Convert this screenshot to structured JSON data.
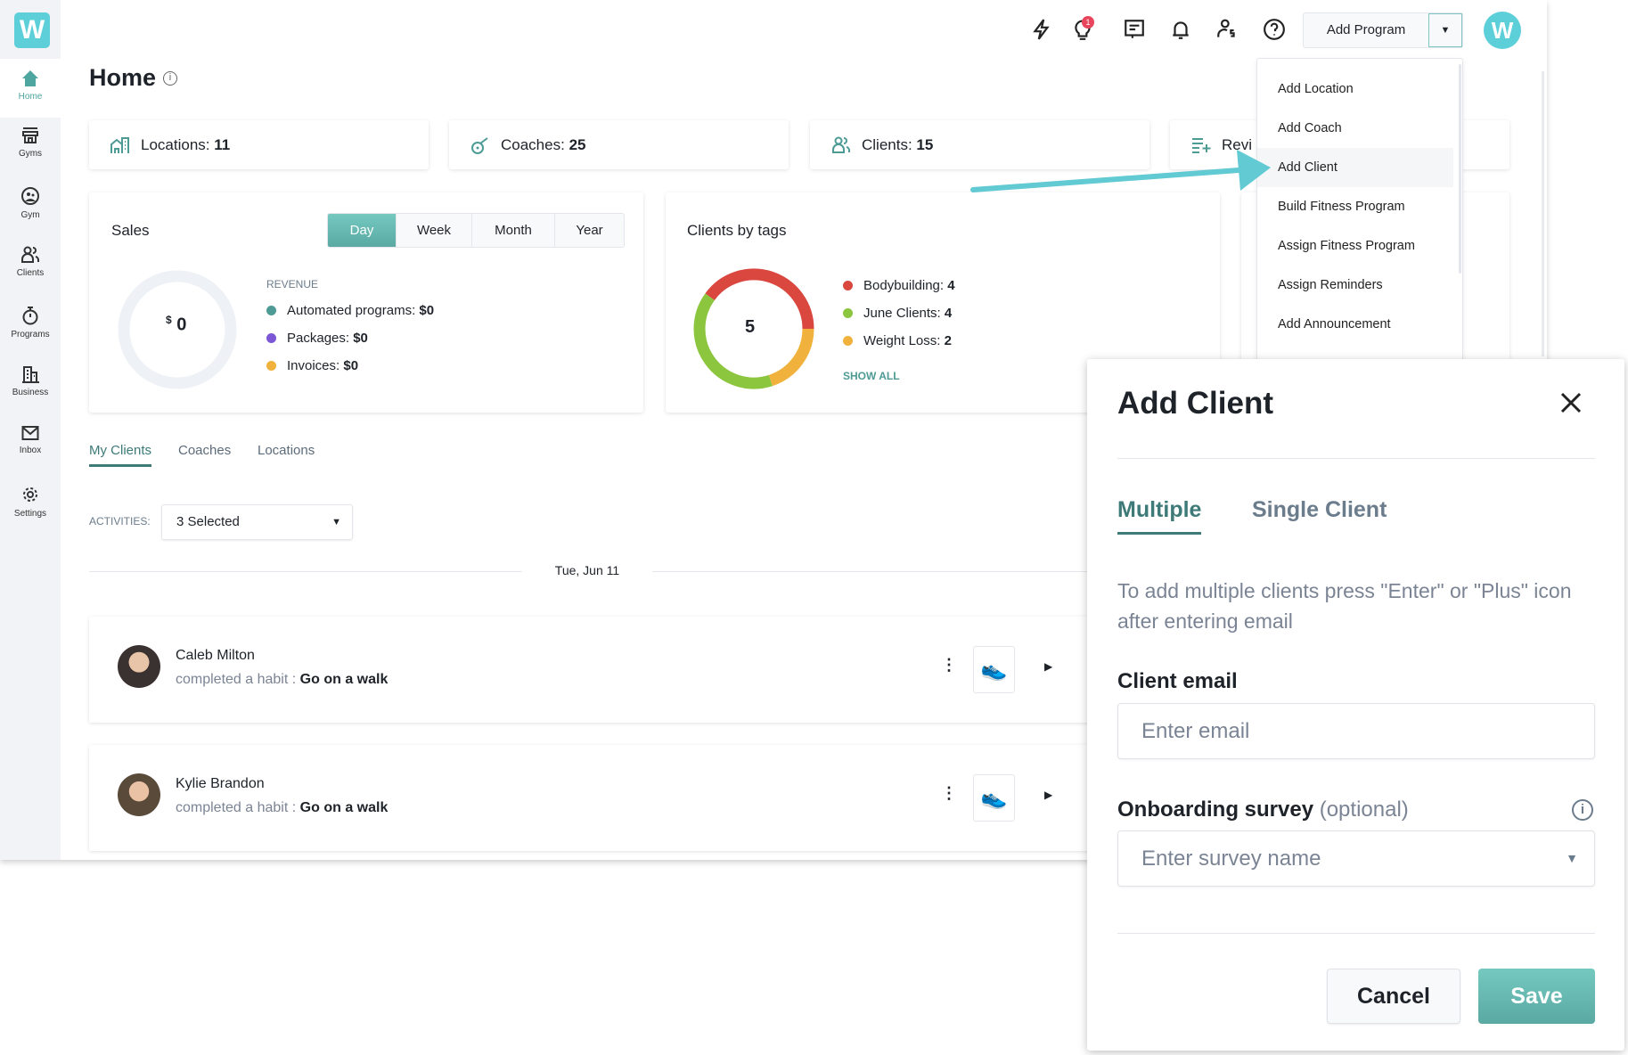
{
  "brand": {
    "logo_letter": "W",
    "accent": "#5bb5ad",
    "arrow_color": "#62cad3"
  },
  "sidebar": {
    "items": [
      {
        "label": "Home",
        "icon": "home-icon"
      },
      {
        "label": "Gyms",
        "icon": "store-icon"
      },
      {
        "label": "Gym",
        "icon": "gym-icon"
      },
      {
        "label": "Clients",
        "icon": "users-icon"
      },
      {
        "label": "Programs",
        "icon": "stopwatch-icon"
      },
      {
        "label": "Business",
        "icon": "building-icon"
      },
      {
        "label": "Inbox",
        "icon": "mail-icon"
      },
      {
        "label": "Settings",
        "icon": "gear-icon"
      }
    ]
  },
  "header": {
    "notification_count": "1",
    "add_program": "Add Program",
    "icons": [
      "bolt-icon",
      "lightbulb-icon",
      "chat-icon",
      "bell-icon",
      "user-dollar-icon",
      "help-icon"
    ]
  },
  "page": {
    "title": "Home"
  },
  "stats": [
    {
      "label": "Locations:",
      "value": "11"
    },
    {
      "label": "Coaches:",
      "value": "25"
    },
    {
      "label": "Clients:",
      "value": "15"
    },
    {
      "label": "Revi",
      "value": ""
    }
  ],
  "sales": {
    "title": "Sales",
    "periods": [
      "Day",
      "Week",
      "Month",
      "Year"
    ],
    "active_period": "Day",
    "currency": "$",
    "total": "0",
    "revenue_label": "REVENUE",
    "items": [
      {
        "label": "Automated programs:",
        "value": "$0",
        "color": "#4e9a95"
      },
      {
        "label": "Packages:",
        "value": "$0",
        "color": "#7b57d6"
      },
      {
        "label": "Invoices:",
        "value": "$0",
        "color": "#f0b23c"
      }
    ]
  },
  "tags": {
    "title": "Clients by tags",
    "center": "5",
    "show_all": "SHOW ALL",
    "items": [
      {
        "label": "Bodybuilding:",
        "value": 4,
        "color": "#d9473f"
      },
      {
        "label": "June Clients:",
        "value": 4,
        "color": "#8cc63f"
      },
      {
        "label": "Weight Loss:",
        "value": 2,
        "color": "#f0b23c"
      }
    ]
  },
  "tabs": {
    "items": [
      "My Clients",
      "Coaches",
      "Locations"
    ],
    "active": "My Clients"
  },
  "activities": {
    "label": "ACTIVITIES:",
    "value": "3 Selected"
  },
  "feed": {
    "date": "Tue, Jun 11",
    "rows": [
      {
        "name": "Caleb Milton",
        "action": "completed a habit :",
        "habit": "Go on a walk"
      },
      {
        "name": "Kylie Brandon",
        "action": "completed a habit :",
        "habit": "Go on a walk"
      }
    ]
  },
  "dropdown": {
    "items": [
      "Add Location",
      "Add Coach",
      "Add Client",
      "Build Fitness Program",
      "Assign Fitness Program",
      "Assign Reminders",
      "Add Announcement"
    ],
    "highlighted": "Add Client"
  },
  "modal": {
    "title": "Add Client",
    "tabs": [
      "Multiple",
      "Single Client"
    ],
    "active_tab": "Multiple",
    "help": "To add multiple clients press \"Enter\" or \"Plus\" icon after entering email",
    "email_label": "Client email",
    "email_placeholder": "Enter email",
    "survey_label": "Onboarding survey",
    "survey_optional": "(optional)",
    "survey_placeholder": "Enter survey name",
    "cancel": "Cancel",
    "save": "Save"
  }
}
